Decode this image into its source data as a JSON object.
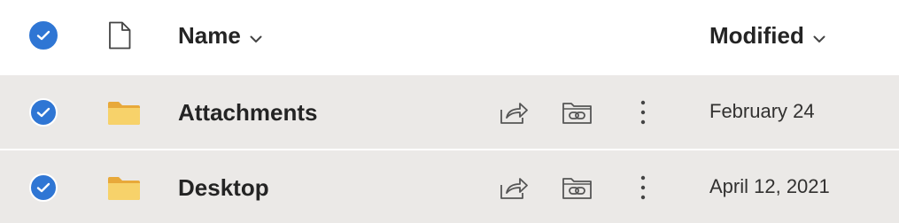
{
  "header": {
    "name_label": "Name",
    "modified_label": "Modified",
    "select_all_checked": true
  },
  "rows": [
    {
      "name": "Attachments",
      "modified": "February 24",
      "type": "folder",
      "selected": true
    },
    {
      "name": "Desktop",
      "modified": "April 12, 2021",
      "type": "folder",
      "selected": true
    }
  ],
  "colors": {
    "accent": "#2f76d4",
    "selected_row": "#ebe9e7",
    "folder": "#f5c54e"
  },
  "icons": {
    "file": "file-icon",
    "folder": "folder-icon",
    "check": "checkmark-icon",
    "share": "share-icon",
    "copy_link": "copy-link-icon",
    "more": "more-options-icon",
    "sort": "chevron-down-icon"
  }
}
